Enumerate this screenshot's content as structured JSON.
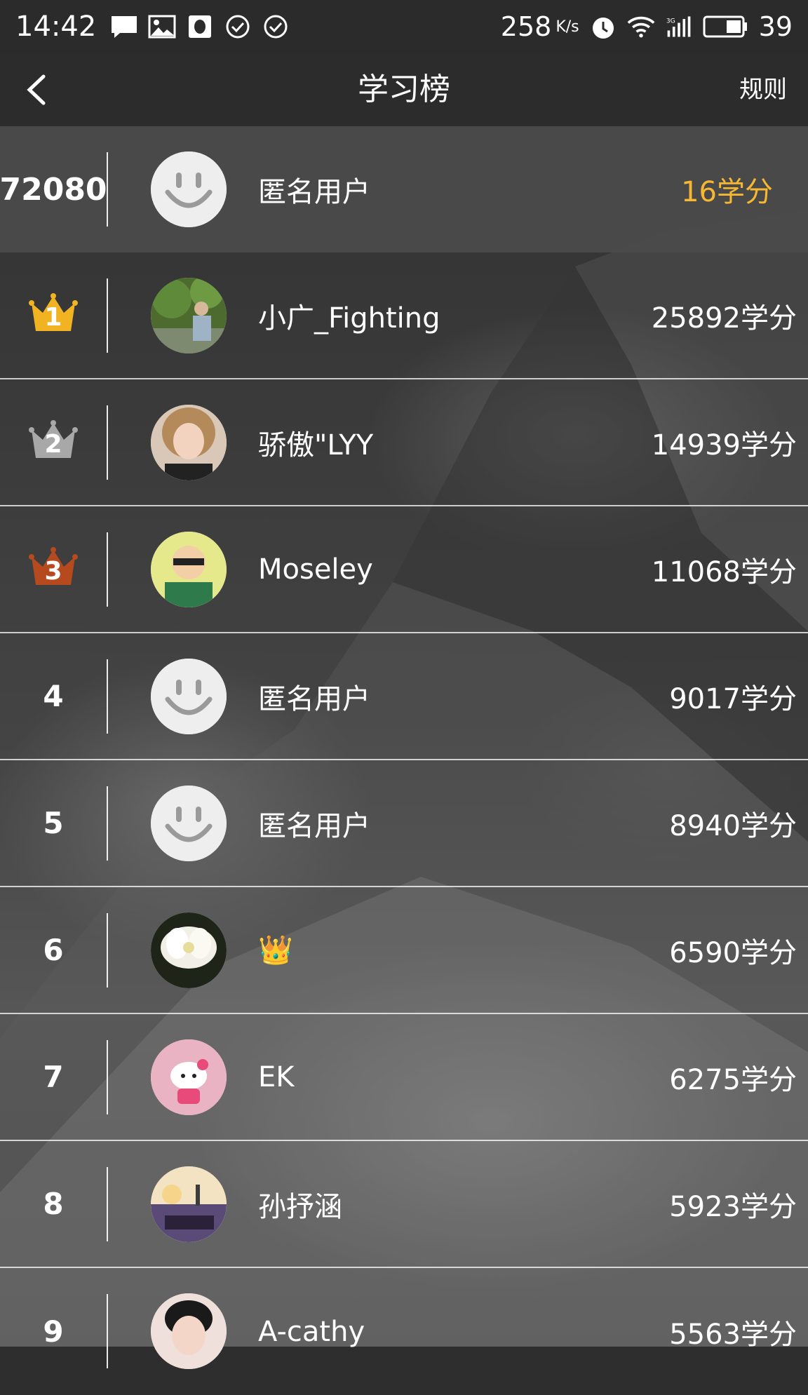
{
  "status_bar": {
    "time": "14:42",
    "network_speed": "258",
    "network_unit": "K/s",
    "battery": "39"
  },
  "header": {
    "title": "学习榜",
    "rules_label": "规则"
  },
  "me": {
    "rank": "72080",
    "name": "匿名用户",
    "score": "16学分"
  },
  "rows": [
    {
      "rank": "1",
      "name": "小广_Fighting",
      "score": "25892学分",
      "medal": "gold"
    },
    {
      "rank": "2",
      "name": "骄傲\"LYY",
      "score": "14939学分",
      "medal": "silver"
    },
    {
      "rank": "3",
      "name": "Moseley",
      "score": "11068学分",
      "medal": "bronze"
    },
    {
      "rank": "4",
      "name": "匿名用户",
      "score": "9017学分"
    },
    {
      "rank": "5",
      "name": "匿名用户",
      "score": "8940学分"
    },
    {
      "rank": "6",
      "name": "👑",
      "score": "6590学分"
    },
    {
      "rank": "7",
      "name": "EK",
      "score": "6275学分"
    },
    {
      "rank": "8",
      "name": "孙抒涵",
      "score": "5923学分"
    },
    {
      "rank": "9",
      "name": "A-cathy",
      "score": "5563学分"
    }
  ],
  "colors": {
    "accent_score": "#f6b733",
    "gold": "#f2b322",
    "silver": "#a8a8a8",
    "bronze": "#b54a1e"
  }
}
